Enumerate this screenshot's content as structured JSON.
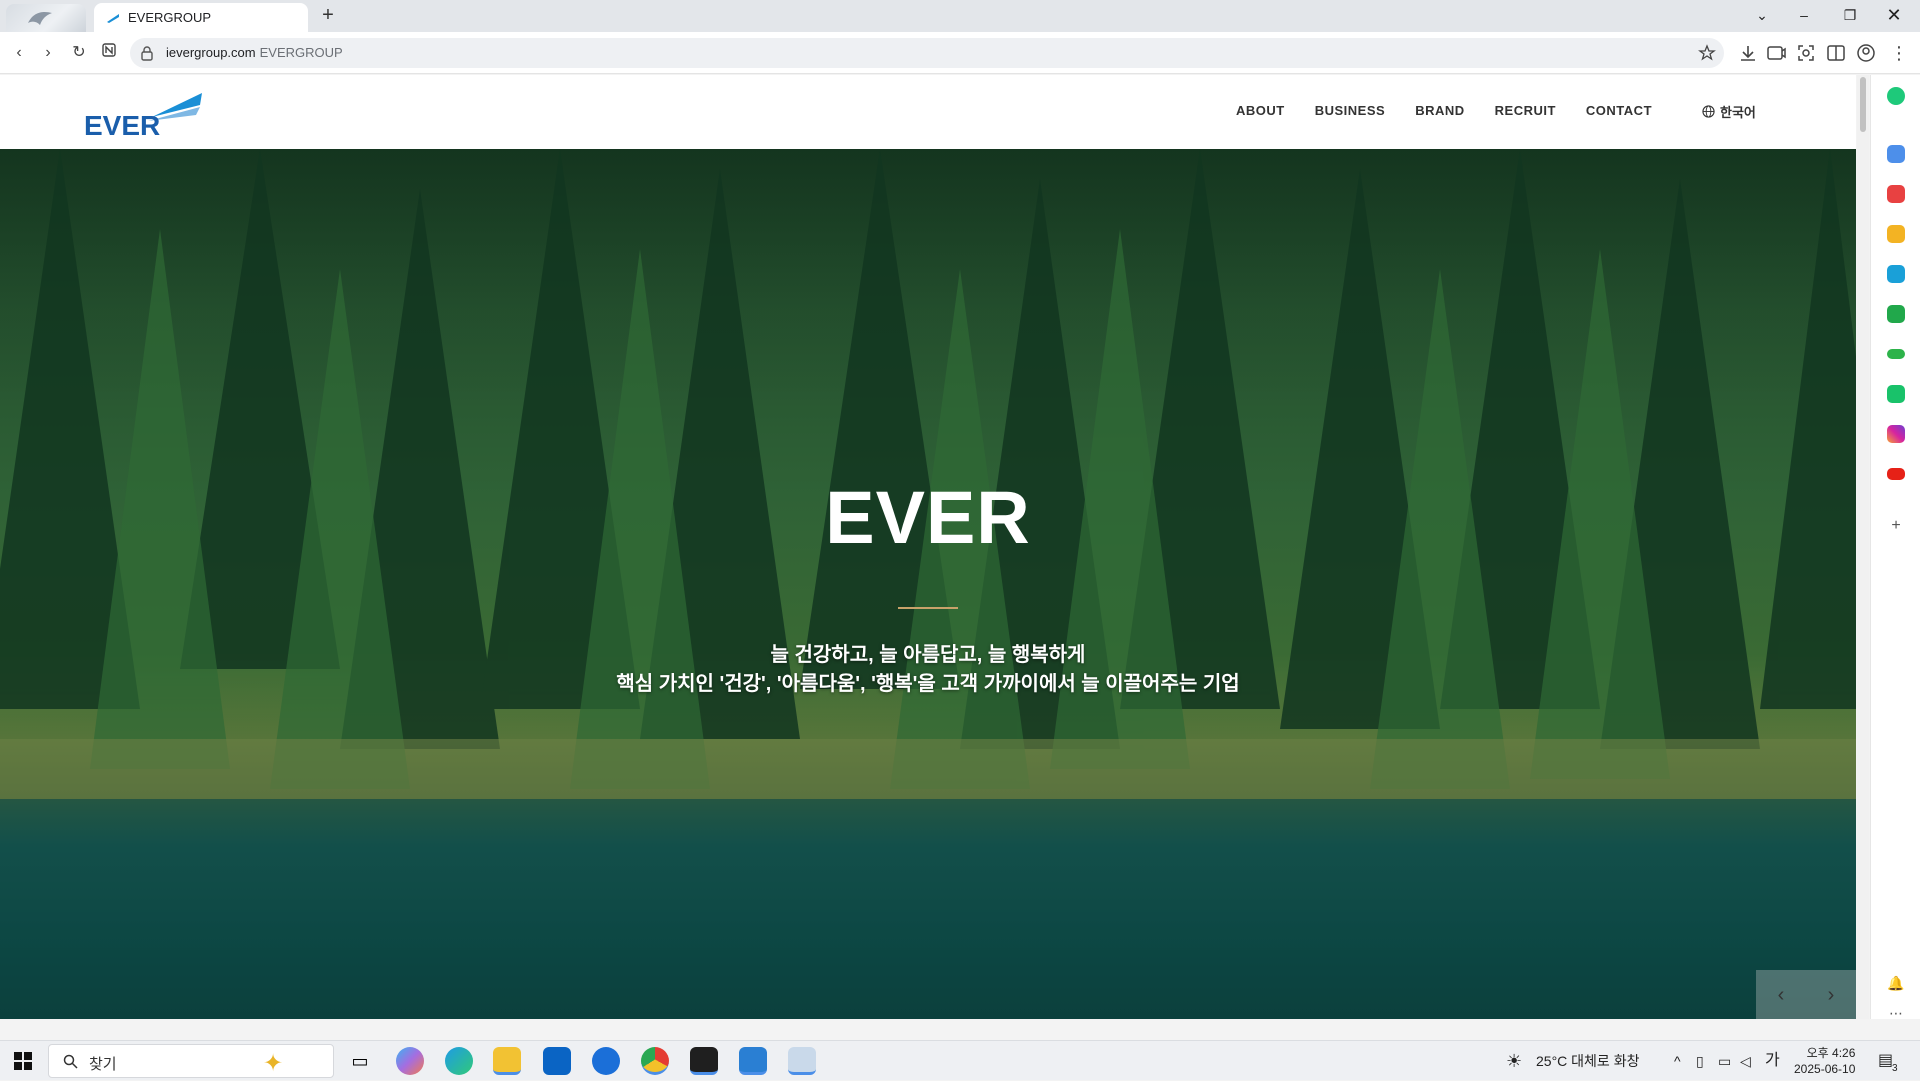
{
  "browser": {
    "tab_title": "EVERGROUP",
    "url": "ievergroup.com",
    "url_title": "EVERGROUP"
  },
  "site": {
    "logo_text": "EVER",
    "nav": [
      "ABOUT",
      "BUSINESS",
      "BRAND",
      "RECRUIT",
      "CONTACT"
    ],
    "language": "한국어"
  },
  "hero": {
    "title": "EVER",
    "line1": "늘 건강하고, 늘 아름답고, 늘 행복하게",
    "line2": "핵심 가치인 '건강', '아름다움', '행복'을 고객 가까이에서 늘 이끌어주는 기업",
    "prev_label": "‹",
    "next_label": "›"
  },
  "taskbar": {
    "search_placeholder": "찾기",
    "weather": "25°C  대체로 화창",
    "ime": "가",
    "time": "오후 4:26",
    "date": "2025-06-10",
    "notification_count": "3"
  },
  "colors": {
    "accent_blue": "#1a5eab",
    "hero_line": "#c8a26a"
  }
}
